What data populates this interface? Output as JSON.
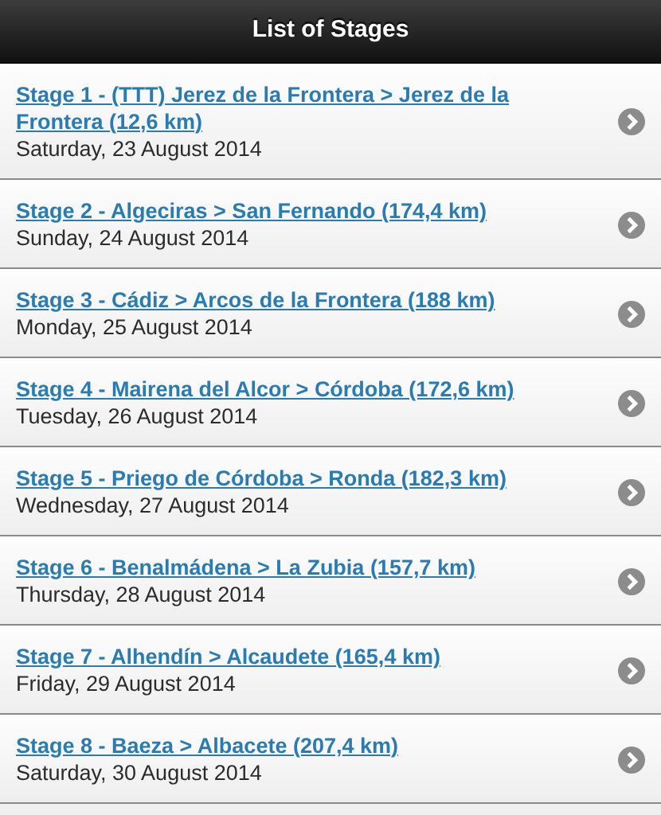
{
  "header": {
    "title": "List of Stages"
  },
  "stages": [
    {
      "title": "Stage 1 - (TTT) Jerez de la Frontera > Jerez de la Frontera (12,6 km)",
      "date": "Saturday, 23 August 2014"
    },
    {
      "title": "Stage 2 - Algeciras > San Fernando (174,4 km)",
      "date": "Sunday, 24 August 2014"
    },
    {
      "title": "Stage 3 - Cádiz > Arcos de la Frontera (188 km)",
      "date": "Monday, 25 August 2014"
    },
    {
      "title": "Stage 4 - Mairena del Alcor > Córdoba (172,6 km)",
      "date": "Tuesday, 26 August 2014"
    },
    {
      "title": "Stage 5 - Priego de Córdoba > Ronda (182,3 km)",
      "date": "Wednesday, 27 August 2014"
    },
    {
      "title": "Stage 6 - Benalmádena > La Zubia (157,7 km)",
      "date": "Thursday, 28 August 2014"
    },
    {
      "title": "Stage 7 - Alhendín > Alcaudete (165,4 km)",
      "date": "Friday, 29 August 2014"
    },
    {
      "title": "Stage 8 - Baeza > Albacete (207,4 km)",
      "date": "Saturday, 30 August 2014"
    }
  ]
}
